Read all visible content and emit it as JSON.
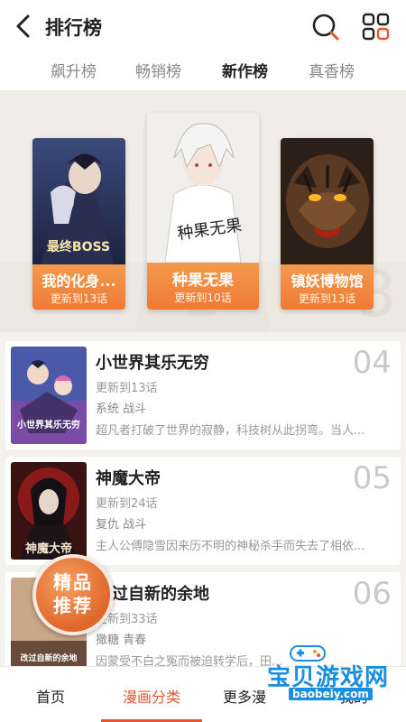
{
  "header": {
    "title": "排行榜"
  },
  "tabs": [
    {
      "label": "飙升榜"
    },
    {
      "label": "畅销榜"
    },
    {
      "label": "新作榜"
    },
    {
      "label": "真香榜"
    }
  ],
  "podium": [
    {
      "name": "我的化身...",
      "updated": "更新到13话",
      "cover_text": "最终BOSS"
    },
    {
      "name": "种果无果",
      "updated": "更新到10话",
      "cover_text": "种果无果"
    },
    {
      "name": "镇妖博物馆",
      "updated": "更新到13话"
    }
  ],
  "list": [
    {
      "rank": "04",
      "name": "小世界其乐无穷",
      "updated": "更新到13话",
      "tags": "系统  战斗",
      "desc": "超凡者打破了世界的寂静，科技树从此拐弯。当人...",
      "cover_text": "小世界其乐无穷"
    },
    {
      "rank": "05",
      "name": "神魔大帝",
      "updated": "更新到24话",
      "tags": "复仇  战斗",
      "desc": "主人公傅隐雪因来历不明的神秘杀手而失去了相依...",
      "cover_text": "神魔大帝"
    },
    {
      "rank": "06",
      "name": "改过自新的余地",
      "updated": "更新到33话",
      "tags": "撒糖  青春",
      "desc": "因蒙受不白之冤而被迫转学后，田...",
      "cover_text": "改过自新的余地"
    }
  ],
  "badge": {
    "line1": "精品",
    "line2": "推荐"
  },
  "bottom_nav": [
    {
      "label": "首页"
    },
    {
      "label": "漫画分类"
    },
    {
      "label": "更多漫"
    },
    {
      "label": "我的"
    }
  ],
  "watermark": {
    "title": "宝贝游戏网",
    "url": "baobeiy.com"
  },
  "colors": {
    "accent": "#e4572e",
    "card_caption": "#ef7a35",
    "watermark": "#1a8fe0"
  }
}
